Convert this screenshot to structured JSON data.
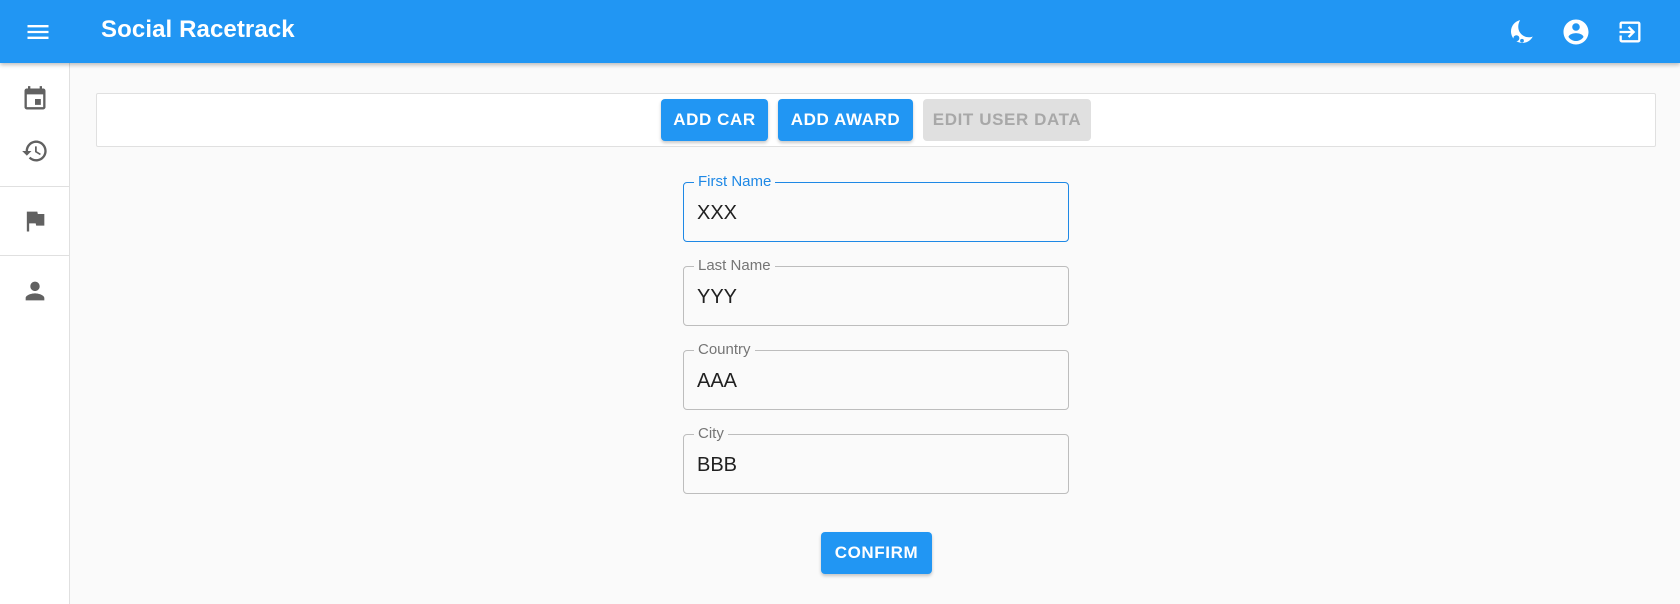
{
  "app": {
    "title": "Social Racetrack"
  },
  "topbar": {
    "menu_icon": "hamburger-menu-icon",
    "theme_icon": "theme-toggle-icon",
    "account_icon": "account-circle-icon",
    "logout_icon": "logout-icon"
  },
  "sidebar": {
    "items": [
      {
        "icon": "calendar-icon"
      },
      {
        "icon": "history-icon"
      },
      {
        "icon": "flag-icon"
      },
      {
        "icon": "person-icon"
      }
    ]
  },
  "toolbar": {
    "add_car": "ADD CAR",
    "add_award": "ADD AWARD",
    "edit_user_data": "EDIT USER DATA"
  },
  "form": {
    "first_name": {
      "label": "First Name",
      "value": "XXX"
    },
    "last_name": {
      "label": "Last Name",
      "value": "YYY"
    },
    "country": {
      "label": "Country",
      "value": "AAA"
    },
    "city": {
      "label": "City",
      "value": "BBB"
    },
    "confirm": "CONFIRM"
  },
  "colors": {
    "primary": "#2196f3",
    "background": "#fafafa",
    "disabled": "#e0e0e0"
  }
}
